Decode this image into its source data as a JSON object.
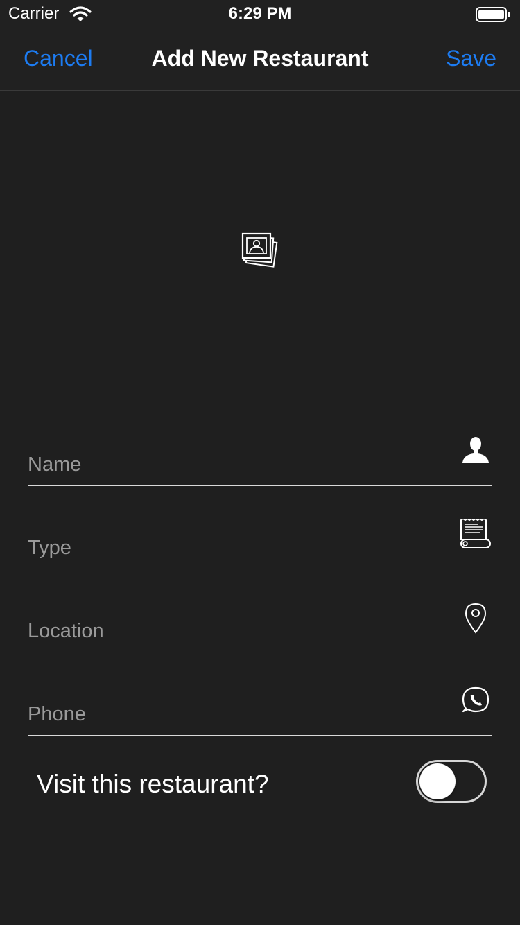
{
  "status_bar": {
    "carrier": "Carrier",
    "time": "6:29 PM",
    "icons": [
      "wifi-icon",
      "battery-icon"
    ]
  },
  "navbar": {
    "cancel_label": "Cancel",
    "title": "Add New Restaurant",
    "save_label": "Save",
    "accent_color": "#1d7cf2"
  },
  "photo": {
    "icon": "photo-stack-icon"
  },
  "form": {
    "fields": [
      {
        "placeholder": "Name",
        "value": "",
        "icon": "person-icon"
      },
      {
        "placeholder": "Type",
        "value": "",
        "icon": "receipt-icon"
      },
      {
        "placeholder": "Location",
        "value": "",
        "icon": "location-pin-icon"
      },
      {
        "placeholder": "Phone",
        "value": "",
        "icon": "phone-chat-icon"
      }
    ],
    "visit_label": "Visit this restaurant?",
    "visit_on": false
  },
  "colors": {
    "background": "#1f1f1f",
    "bar": "#212121",
    "text": "#ffffff",
    "placeholder": "#9a9a9a"
  }
}
